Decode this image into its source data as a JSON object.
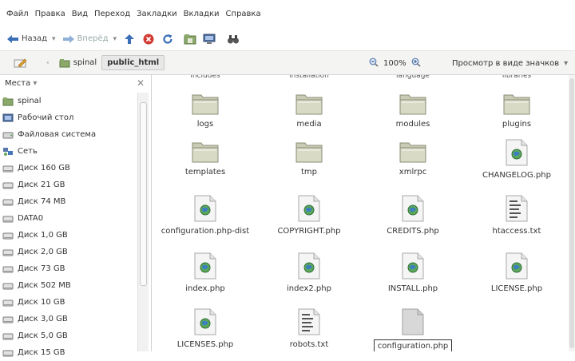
{
  "menu": {
    "items": [
      "Файл",
      "Правка",
      "Вид",
      "Переход",
      "Закладки",
      "Вкладки",
      "Справка"
    ]
  },
  "toolbar": {
    "back_label": "Назад",
    "forward_label": "Вперёд"
  },
  "location": {
    "crumbs": [
      "spinal",
      "public_html"
    ],
    "zoom": "100%",
    "view_mode": "Просмотр в виде значков"
  },
  "sidebar": {
    "title": "Места",
    "items": [
      {
        "label": "spinal",
        "icon": "folder-icon"
      },
      {
        "label": "Рабочий стол",
        "icon": "desktop-icon"
      },
      {
        "label": "Файловая система",
        "icon": "filesystem-icon"
      },
      {
        "label": "Сеть",
        "icon": "network-icon"
      },
      {
        "label": "Диск 160 GB",
        "icon": "drive-icon"
      },
      {
        "label": "Диск 21 GB",
        "icon": "drive-icon"
      },
      {
        "label": "Диск 74 MB",
        "icon": "drive-icon"
      },
      {
        "label": "DATA0",
        "icon": "drive-icon"
      },
      {
        "label": "Диск 1,0 GB",
        "icon": "drive-icon"
      },
      {
        "label": "Диск 2,0 GB",
        "icon": "drive-icon"
      },
      {
        "label": "Диск 73 GB",
        "icon": "drive-icon"
      },
      {
        "label": "Диск 502 MB",
        "icon": "drive-icon"
      },
      {
        "label": "Диск 10 GB",
        "icon": "drive-icon"
      },
      {
        "label": "Диск 3,0 GB",
        "icon": "drive-icon"
      },
      {
        "label": "Диск 5,0 GB",
        "icon": "drive-icon"
      },
      {
        "label": "Диск 15 GB",
        "icon": "drive-icon"
      }
    ]
  },
  "files": {
    "partial_row": [
      "includes",
      "installation",
      "language",
      "libraries"
    ],
    "items": [
      {
        "name": "logs",
        "type": "folder"
      },
      {
        "name": "media",
        "type": "folder"
      },
      {
        "name": "modules",
        "type": "folder"
      },
      {
        "name": "plugins",
        "type": "folder"
      },
      {
        "name": "templates",
        "type": "folder"
      },
      {
        "name": "tmp",
        "type": "folder"
      },
      {
        "name": "xmlrpc",
        "type": "folder"
      },
      {
        "name": "CHANGELOG.php",
        "type": "php"
      },
      {
        "name": "configuration.php-dist",
        "type": "php"
      },
      {
        "name": "COPYRIGHT.php",
        "type": "php"
      },
      {
        "name": "CREDITS.php",
        "type": "php"
      },
      {
        "name": "htaccess.txt",
        "type": "txt"
      },
      {
        "name": "index.php",
        "type": "php"
      },
      {
        "name": "index2.php",
        "type": "php"
      },
      {
        "name": "INSTALL.php",
        "type": "php"
      },
      {
        "name": "LICENSE.php",
        "type": "php"
      },
      {
        "name": "LICENSES.php",
        "type": "php"
      },
      {
        "name": "robots.txt",
        "type": "txt"
      },
      {
        "name": "configuration.php",
        "type": "blank",
        "editing": true
      }
    ]
  }
}
